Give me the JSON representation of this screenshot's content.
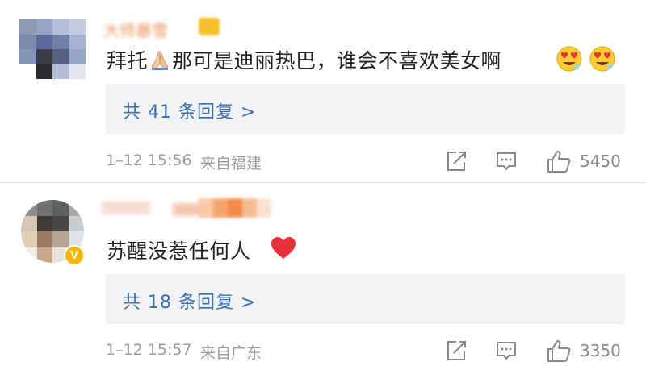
{
  "comments": [
    {
      "user_name": "大师暴雪",
      "text": "拜托🙏那可是迪丽热巴，谁会不喜欢美女啊",
      "text_before_emoji": "拜托",
      "text_after_emoji": "那可是迪丽热巴，谁会不喜欢美女啊",
      "emoji_icon": "folded-hands-icon",
      "trailing_emojis": [
        "heart-eyes-face-icon",
        "heart-eyes-face-icon"
      ],
      "replies_label": "共 41 条回复 >",
      "timestamp": "1–12 15:56",
      "location": "来自福建",
      "likes": "5450"
    },
    {
      "user_name": "",
      "text": "苏醒没惹任何人",
      "trailing_emojis": [
        "red-heart-icon"
      ],
      "verified": true,
      "replies_label": "共 18 条回复 >",
      "timestamp": "1–12 15:57",
      "location": "来自广东",
      "likes": "3350"
    }
  ],
  "colors": {
    "link": "#3c6eb4",
    "meta": "#9c9c9c",
    "reply_bg": "#f2f3f5",
    "badge": "#f7b500"
  }
}
